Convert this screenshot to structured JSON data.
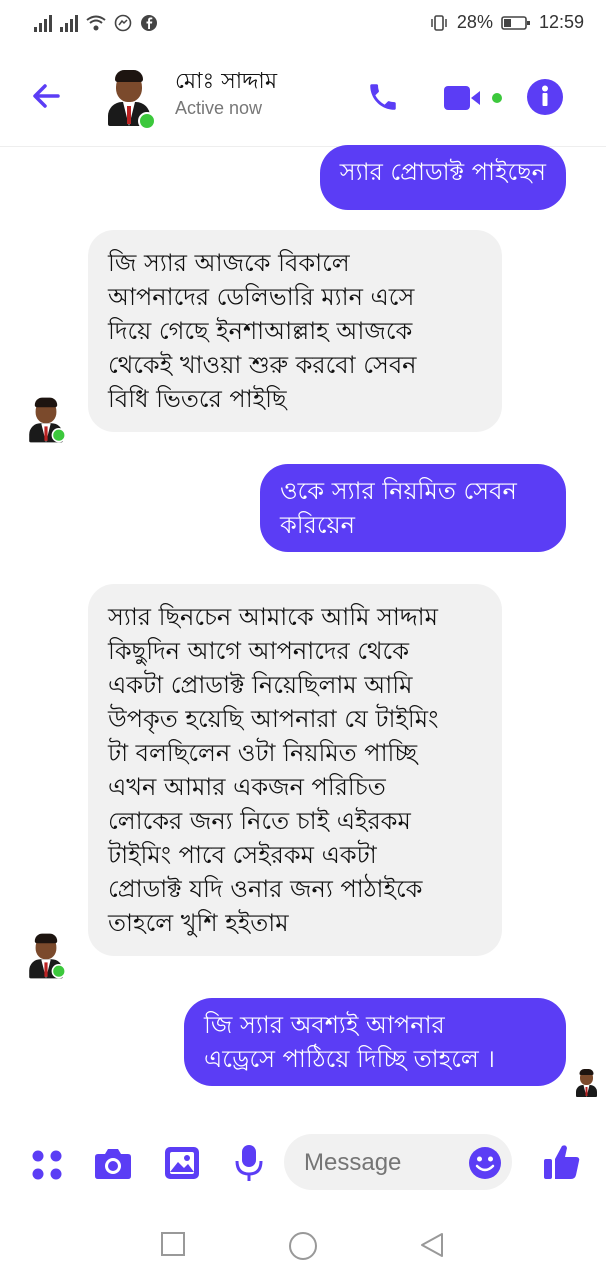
{
  "statusbar": {
    "battery": "28%",
    "time": "12:59"
  },
  "header": {
    "name": "মোঃ সাদ্দাম",
    "status": "Active now"
  },
  "messages": [
    {
      "dir": "out",
      "text": "স্যার প্রোডাক্ট পাইছেন"
    },
    {
      "dir": "in",
      "text": "জি স্যার আজকে বিকালে\nআপনাদের ডেলিভারি ম্যান এসে\nদিয়ে গেছে ইনশাআল্লাহ আজকে\nথেকেই খাওয়া শুরু করবো সেবন\nবিধি ভিতরে পাইছি"
    },
    {
      "dir": "out",
      "text": "ওকে স্যার নিয়মিত সেবন\nকরিয়েন"
    },
    {
      "dir": "in",
      "text": "স্যার ছিনচেন আমাকে আমি সাদ্দাম\nকিছুদিন আগে আপনাদের থেকে\nএকটা প্রোডাক্ট নিয়েছিলাম আমি\nউপকৃত হয়েছি  আপনারা যে টাইমিং\nটা বলছিলেন ওটা নিয়মিত পাচ্ছি\nএখন আমার একজন পরিচিত\nলোকের জন্য নিতে চাই এইরকম\nটাইমিং পাবে সেইরকম একটা\nপ্রোডাক্ট যদি ওনার জন্য পাঠাইকে\nতাহলে খুশি হইতাম"
    },
    {
      "dir": "out",
      "text": "জি স্যার অবশ্যই আপনার\nএড্রেসে পাঠিয়ে দিচ্ছি তাহলে ।"
    }
  ],
  "composer": {
    "placeholder": "Message"
  },
  "colors": {
    "accent": "#5b3df5",
    "incoming_bg": "#f1f1f1",
    "online": "#3cc83c"
  },
  "icons": [
    "back-arrow-icon",
    "phone-icon",
    "video-camera-icon",
    "info-icon",
    "menu-dots-icon",
    "camera-icon",
    "gallery-icon",
    "microphone-icon",
    "emoji-icon",
    "thumbs-up-icon",
    "nav-square-icon",
    "nav-circle-icon",
    "nav-back-icon"
  ]
}
